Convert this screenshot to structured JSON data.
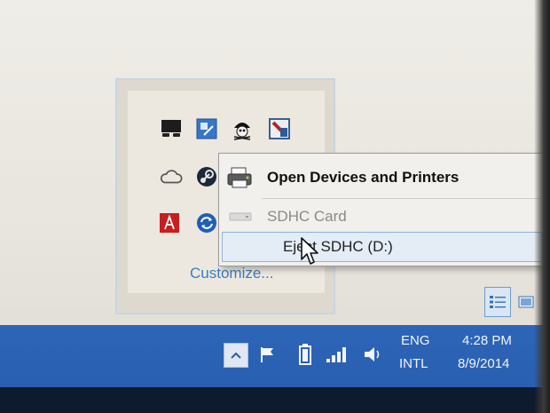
{
  "tray_overflow": {
    "icons": [
      "display-icon",
      "app-icon",
      "pirate-icon",
      "shield-icon",
      "cloud-icon",
      "steam-icon",
      "printer-icon",
      "app-icon-partial",
      "adobe-icon",
      "sync-icon"
    ],
    "customize_label": "Customize..."
  },
  "context_menu": {
    "items": [
      {
        "label": "Open Devices and Printers",
        "icon": "printer-icon",
        "style": "bold"
      },
      {
        "label": "SDHC Card",
        "icon": "sd-card-icon",
        "style": "disabled"
      },
      {
        "label": "Eject SDHC (D:)",
        "icon": "",
        "style": "hover"
      }
    ]
  },
  "taskbar": {
    "language_line1": "ENG",
    "language_line2": "INTL",
    "time": "4:28 PM",
    "date": "8/9/2014"
  },
  "colors": {
    "taskbar": "#2a5fb0",
    "menu_bg": "#f1f0ed",
    "hover_bg": "#e4ecf6",
    "link": "#3e7bbd"
  }
}
